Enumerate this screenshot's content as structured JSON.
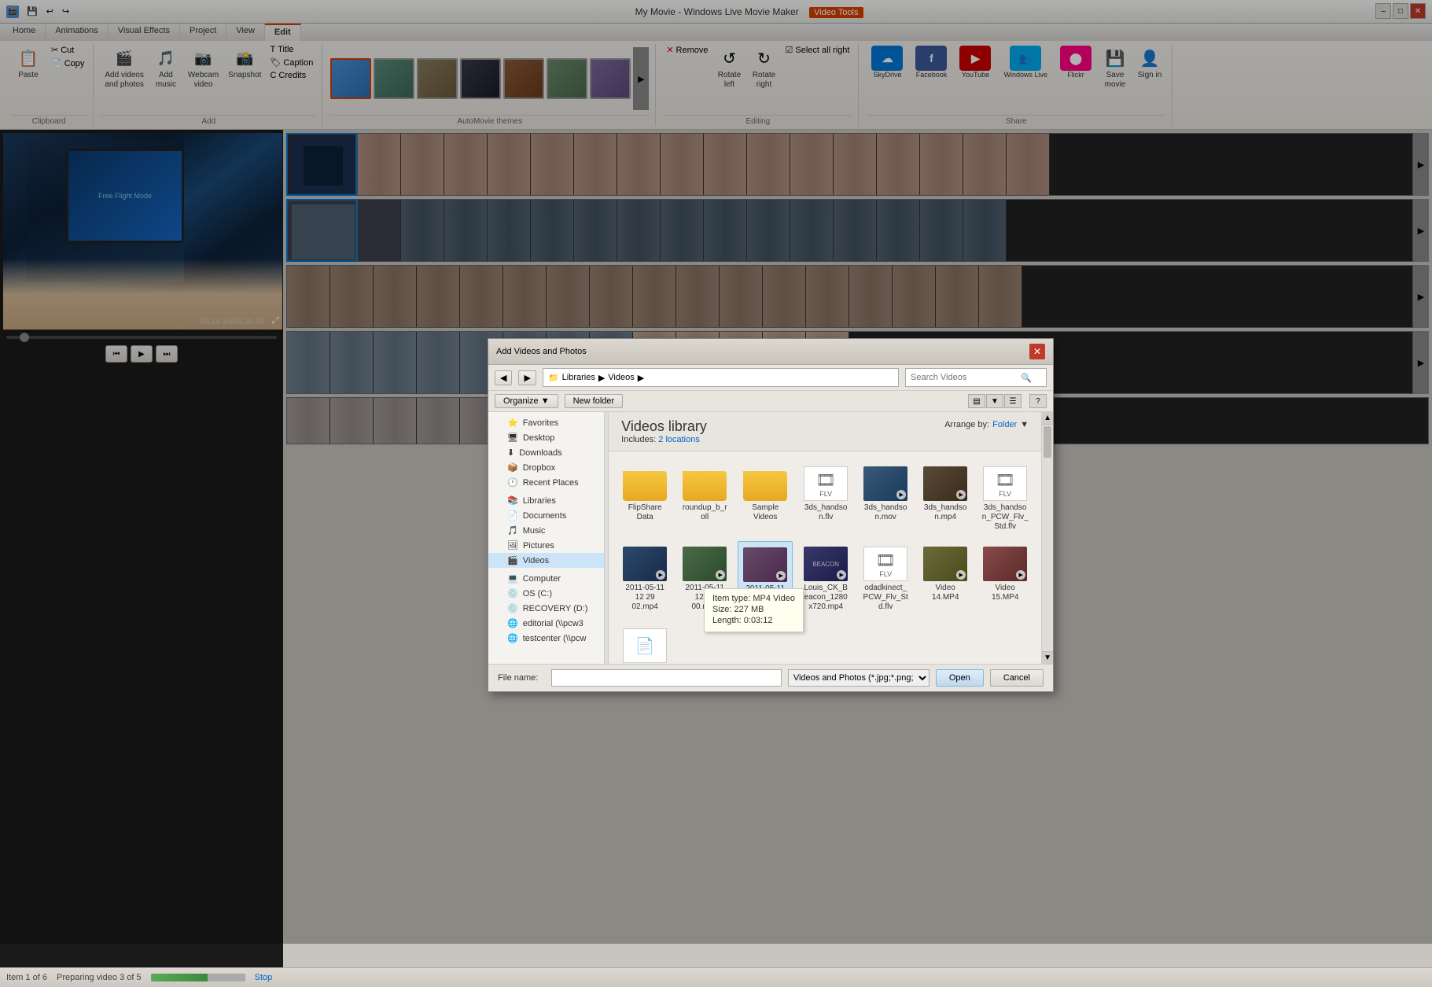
{
  "window": {
    "title": "My Movie - Windows Live Movie Maker",
    "video_tools_label": "Video Tools",
    "min_btn": "–",
    "max_btn": "□",
    "close_btn": "✕"
  },
  "ribbon": {
    "tabs": [
      "Home",
      "Animations",
      "Visual Effects",
      "Project",
      "View",
      "Edit"
    ],
    "active_tab": "Edit",
    "video_tools_tab": "Video Tools",
    "groups": {
      "clipboard": {
        "label": "Clipboard",
        "paste_label": "Paste",
        "cut_label": "Cut",
        "copy_label": "Copy"
      },
      "add": {
        "label": "Add",
        "add_videos_label": "Add videos\nand photos",
        "add_music_label": "Add\nmusic",
        "webcam_label": "Webcam\nvideo",
        "snapshot_label": "Snapshot",
        "title_label": "Title",
        "caption_label": "Caption",
        "credits_label": "Credits"
      },
      "automovie": {
        "label": "AutoMovie themes",
        "themes": [
          "theme1",
          "theme2",
          "theme3",
          "theme4",
          "theme5",
          "theme6",
          "theme7"
        ]
      },
      "editing": {
        "label": "Editing",
        "remove_label": "Remove",
        "rotate_left_label": "Rotate\nleft",
        "rotate_right_label": "Rotate\nright",
        "select_all_label": "Select all\nright"
      },
      "share": {
        "label": "Share",
        "skydrive_label": "SkyDrive",
        "facebook_label": "Facebook",
        "youtube_label": "YouTube",
        "windows_live_label": "Windows Live",
        "flickr_label": "Flickr",
        "save_movie_label": "Save\nmovie",
        "sign_in_label": "Sign in"
      }
    }
  },
  "preview": {
    "time_current": "00:14:19",
    "time_total": "09:26.45",
    "video_text": "Free Flight Mode"
  },
  "timeline": {
    "strips": [
      {
        "id": "strip1",
        "type": "person"
      },
      {
        "id": "strip2",
        "type": "person"
      },
      {
        "id": "strip3",
        "type": "dark"
      },
      {
        "id": "strip4",
        "type": "room"
      },
      {
        "id": "strip5",
        "type": "mixed"
      }
    ]
  },
  "dialog": {
    "title": "Add Videos and Photos",
    "close_btn": "✕",
    "nav_back": "◀",
    "nav_forward": "▶",
    "breadcrumb": [
      "Libraries",
      "Videos"
    ],
    "search_placeholder": "Search Videos",
    "organize_label": "Organize",
    "new_folder_label": "New folder",
    "view_btns": [
      "▤",
      "▼"
    ],
    "help_btn": "?",
    "library_title": "Videos library",
    "includes_label": "Includes:",
    "locations_text": "2 locations",
    "arrange_by_label": "Arrange by:",
    "folder_label": "Folder",
    "sidebar": {
      "favorites_label": "Favorites",
      "favorites_items": [
        "Desktop",
        "Downloads",
        "Dropbox",
        "Recent Places"
      ],
      "libraries_label": "Libraries",
      "libraries_items": [
        "Documents",
        "Music",
        "Pictures",
        "Videos"
      ],
      "computer_label": "Computer",
      "computer_items": [
        "OS (C:)",
        "RECOVERY (D:)",
        "editorial (\\\\pcw3",
        "testcenter (\\\\pcw"
      ]
    },
    "files": [
      {
        "name": "FlipShare Data",
        "type": "folder"
      },
      {
        "name": "roundup_b_roll",
        "type": "folder"
      },
      {
        "name": "Sample Videos",
        "type": "folder"
      },
      {
        "name": "3ds_handson.flv",
        "type": "flv"
      },
      {
        "name": "3ds_handson.mov",
        "type": "video"
      },
      {
        "name": "3ds_handson.mp4",
        "type": "video"
      },
      {
        "name": "3ds_handson_PCW_Flv_Std.flv",
        "type": "flv"
      },
      {
        "name": "2011-05-11 12 29 02.mp4",
        "type": "video"
      },
      {
        "name": "2011-05-11 12 33 00.mp4",
        "type": "video"
      },
      {
        "name": "2011-05-11 13 08 58.mp4",
        "type": "video",
        "selected": true
      },
      {
        "name": "Louis_CK_Beacon_1280x720.mp4",
        "type": "video"
      },
      {
        "name": "odadkinect_PCW_Flv_Std.flv",
        "type": "flv"
      },
      {
        "name": "Video 14.MP4",
        "type": "video"
      },
      {
        "name": "Video 15.MP4",
        "type": "video"
      },
      {
        "name": "doc_icon",
        "type": "doc"
      }
    ],
    "tooltip": {
      "visible": true,
      "type_label": "Item type:",
      "type_value": "MP4 Video",
      "size_label": "Size:",
      "size_value": "227 MB",
      "length_label": "Length:",
      "length_value": "0:03:12"
    },
    "file_name_label": "File name:",
    "file_type_label": "Videos and Photos (*.jpg;*.png;",
    "open_btn": "Open",
    "cancel_btn": "Cancel"
  },
  "status_bar": {
    "item_text": "Item 1 of 6",
    "preparing_text": "Preparing video 3 of 5",
    "stop_label": "Stop"
  }
}
